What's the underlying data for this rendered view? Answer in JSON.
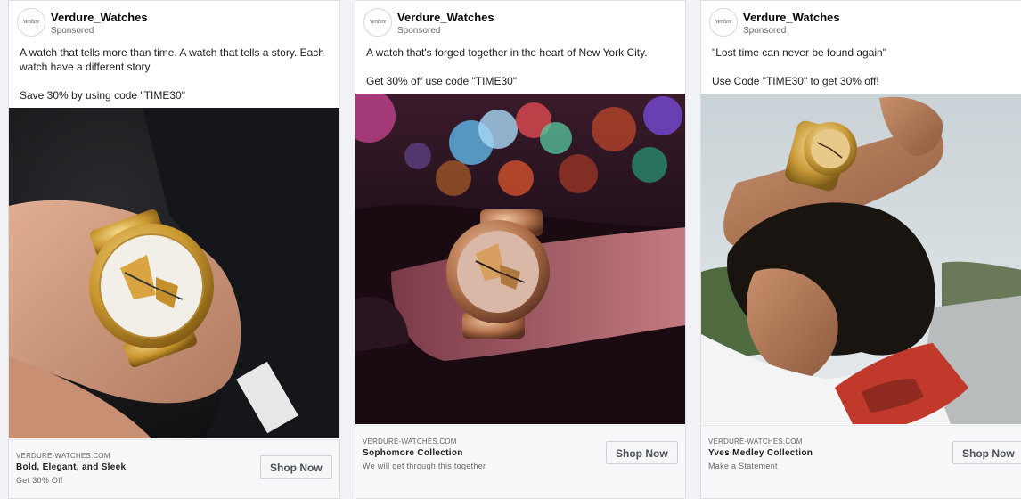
{
  "ads": [
    {
      "page_name": "Verdure_Watches",
      "avatar_text": "Verdure",
      "sponsored": "Sponsored",
      "text": "A watch that tells more than time. A watch that tells a story. Each watch have a different story\n\nSave 30% by using code \"TIME30\"",
      "domain": "VERDURE-WATCHES.COM",
      "headline": "Bold, Elegant, and Sleek",
      "description": "Get 30% Off",
      "cta": "Shop Now"
    },
    {
      "page_name": "Verdure_Watches",
      "avatar_text": "Verdure",
      "sponsored": "Sponsored",
      "text": "A watch that's forged together in the heart of New York City.\n\nGet 30% off use code \"TIME30\"",
      "domain": "VERDURE-WATCHES.COM",
      "headline": "Sophomore Collection",
      "description": "We will get through this together",
      "cta": "Shop Now"
    },
    {
      "page_name": "Verdure_Watches",
      "avatar_text": "Verdure",
      "sponsored": "Sponsored",
      "text": "\"Lost time can never be found again\"\n\nUse Code \"TIME30\" to get 30% off!",
      "domain": "VERDURE-WATCHES.COM",
      "headline": "Yves Medley Collection",
      "description": "Make a Statement",
      "cta": "Shop Now"
    }
  ]
}
